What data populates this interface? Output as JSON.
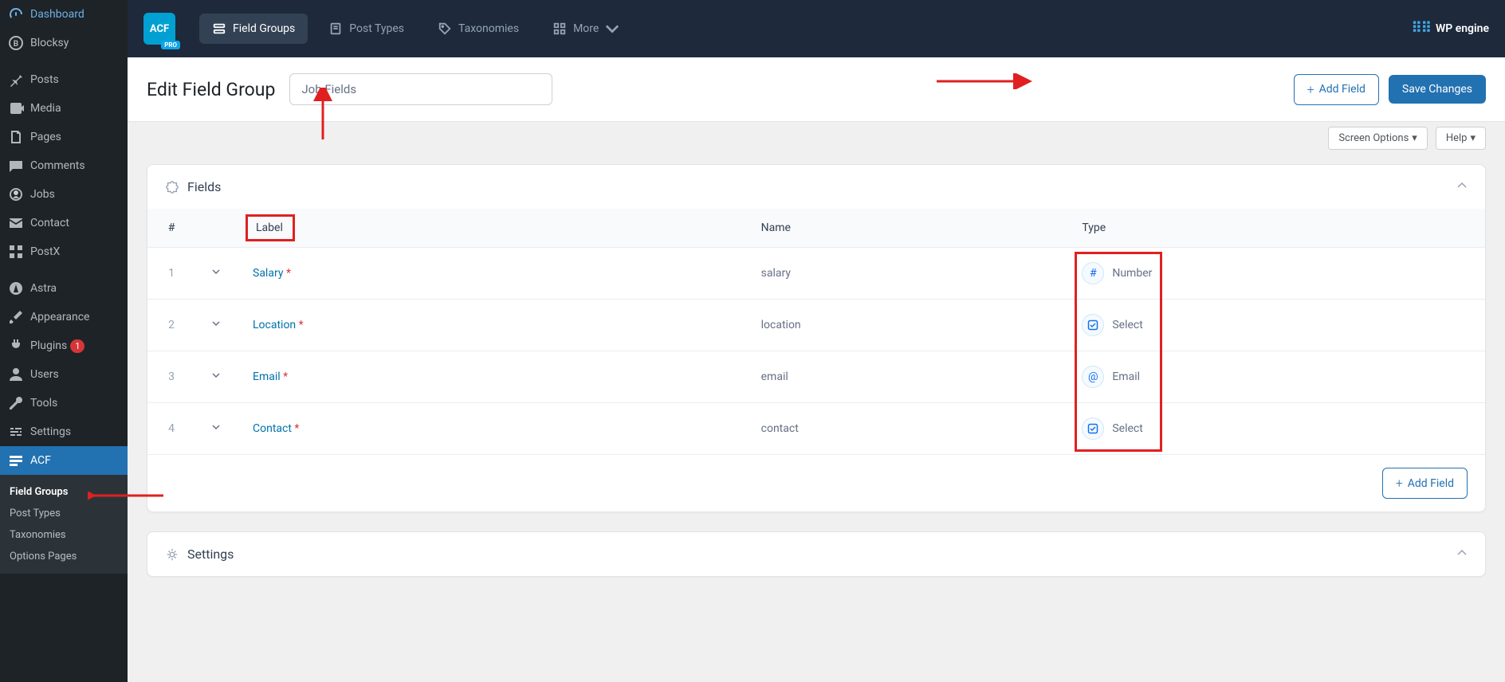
{
  "sidebar": {
    "items": [
      {
        "icon": "gauge",
        "label": "Dashboard"
      },
      {
        "icon": "b-circle",
        "label": "Blocksy"
      },
      {
        "icon": "pin",
        "label": "Posts"
      },
      {
        "icon": "media",
        "label": "Media"
      },
      {
        "icon": "page",
        "label": "Pages"
      },
      {
        "icon": "comment",
        "label": "Comments"
      },
      {
        "icon": "briefcase",
        "label": "Jobs"
      },
      {
        "icon": "envelope",
        "label": "Contact"
      },
      {
        "icon": "grid",
        "label": "PostX"
      },
      {
        "icon": "astra",
        "label": "Astra"
      },
      {
        "icon": "brush",
        "label": "Appearance"
      },
      {
        "icon": "plug",
        "label": "Plugins",
        "badge": "1"
      },
      {
        "icon": "user",
        "label": "Users"
      },
      {
        "icon": "wrench",
        "label": "Tools"
      },
      {
        "icon": "sliders",
        "label": "Settings"
      },
      {
        "icon": "acf",
        "label": "ACF",
        "active": true
      }
    ],
    "sub": [
      {
        "label": "Field Groups",
        "active": true
      },
      {
        "label": "Post Types"
      },
      {
        "label": "Taxonomies"
      },
      {
        "label": "Options Pages"
      }
    ]
  },
  "topbar": {
    "logo": "ACF",
    "pro": "PRO",
    "tabs": [
      {
        "label": "Field Groups",
        "icon": "fields",
        "active": true
      },
      {
        "label": "Post Types",
        "icon": "post"
      },
      {
        "label": "Taxonomies",
        "icon": "tag"
      },
      {
        "label": "More",
        "icon": "grid",
        "chevron": true
      }
    ],
    "brand": "WP engine"
  },
  "header": {
    "title": "Edit Field Group",
    "group_name": "Job Fields",
    "add_field": "Add Field",
    "save": "Save Changes"
  },
  "screen": {
    "options": "Screen Options",
    "help": "Help"
  },
  "fields_panel": {
    "title": "Fields",
    "columns": {
      "order": "#",
      "label": "Label",
      "name": "Name",
      "type": "Type"
    },
    "rows": [
      {
        "order": "1",
        "label": "Salary",
        "required": true,
        "name": "salary",
        "type": "Number",
        "type_icon": "#"
      },
      {
        "order": "2",
        "label": "Location",
        "required": true,
        "name": "location",
        "type": "Select",
        "type_icon": "select"
      },
      {
        "order": "3",
        "label": "Email",
        "required": true,
        "name": "email",
        "type": "Email",
        "type_icon": "@"
      },
      {
        "order": "4",
        "label": "Contact",
        "required": true,
        "name": "contact",
        "type": "Select",
        "type_icon": "select"
      }
    ],
    "add_field": "Add Field"
  },
  "settings_panel": {
    "title": "Settings"
  },
  "colors": {
    "accent": "#2271b1",
    "annotation": "#e02020"
  }
}
